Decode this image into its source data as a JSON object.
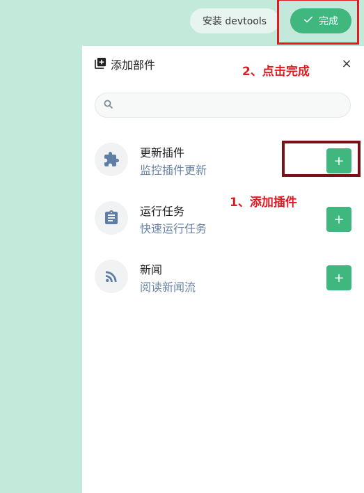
{
  "topbar": {
    "install_label": "安装 devtools",
    "done_label": "完成"
  },
  "panel": {
    "title": "添加部件",
    "close_symbol": "×",
    "search_placeholder": ""
  },
  "annotations": {
    "step2": "2、点击完成",
    "step1": "1、添加插件"
  },
  "items": [
    {
      "title": "更新插件",
      "desc": "监控插件更新",
      "icon": "puzzle-icon",
      "add": "+"
    },
    {
      "title": "运行任务",
      "desc": "快速运行任务",
      "icon": "clipboard-icon",
      "add": "+"
    },
    {
      "title": "新闻",
      "desc": "阅读新闻流",
      "icon": "rss-icon",
      "add": "+"
    }
  ],
  "colors": {
    "background": "#c3e9da",
    "accent": "#3fb77e",
    "annotation_red": "#e11a22",
    "desc_text": "#6a84a6"
  }
}
